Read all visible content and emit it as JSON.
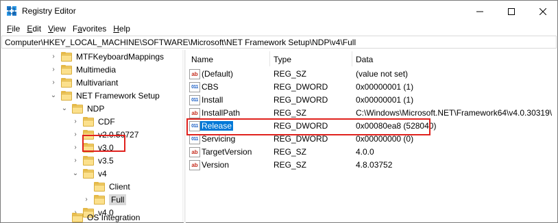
{
  "window": {
    "title": "Registry Editor",
    "icon": "registry-icon"
  },
  "menu": [
    {
      "label": "File",
      "accel": "F",
      "rest": "ile"
    },
    {
      "label": "Edit",
      "accel": "E",
      "rest": "dit"
    },
    {
      "label": "View",
      "accel": "V",
      "rest": "iew"
    },
    {
      "label": "Favorites",
      "accel": "a",
      "pre": "F",
      "rest": "vorites"
    },
    {
      "label": "Help",
      "accel": "H",
      "rest": "elp"
    }
  ],
  "address": "Computer\\HKEY_LOCAL_MACHINE\\SOFTWARE\\Microsoft\\NET Framework Setup\\NDP\\v4\\Full",
  "tree": [
    {
      "label": "MTFKeyboardMappings",
      "chevron": ">"
    },
    {
      "label": "Multimedia",
      "chevron": ">"
    },
    {
      "label": "Multivariant",
      "chevron": ">"
    },
    {
      "label": "NET Framework Setup",
      "chevron": "v"
    },
    {
      "label": "NDP",
      "chevron": "v"
    },
    {
      "label": "CDF",
      "chevron": ">"
    },
    {
      "label": "v2.0.50727",
      "chevron": ">"
    },
    {
      "label": "v3.0",
      "chevron": ">"
    },
    {
      "label": "v3.5",
      "chevron": ">"
    },
    {
      "label": "v4",
      "chevron": "v"
    },
    {
      "label": "Client",
      "chevron": ""
    },
    {
      "label": "Full",
      "chevron": ">"
    },
    {
      "label": "v4.0",
      "chevron": ">"
    },
    {
      "label": "OS Integration",
      "chevron": ""
    }
  ],
  "columns": {
    "name": "Name",
    "type": "Type",
    "data": "Data"
  },
  "values": [
    {
      "name": "(Default)",
      "type": "REG_SZ",
      "data": "(value not set)",
      "icon": "string-value-icon"
    },
    {
      "name": "CBS",
      "type": "REG_DWORD",
      "data": "0x00000001 (1)",
      "icon": "dword-value-icon"
    },
    {
      "name": "Install",
      "type": "REG_DWORD",
      "data": "0x00000001 (1)",
      "icon": "dword-value-icon"
    },
    {
      "name": "InstallPath",
      "type": "REG_SZ",
      "data": "C:\\Windows\\Microsoft.NET\\Framework64\\v4.0.30319\\",
      "icon": "string-value-icon"
    },
    {
      "name": "Release",
      "type": "REG_DWORD",
      "data": "0x00080ea8 (528040)",
      "icon": "dword-value-icon"
    },
    {
      "name": "Servicing",
      "type": "REG_DWORD",
      "data": "0x00000000 (0)",
      "icon": "dword-value-icon"
    },
    {
      "name": "TargetVersion",
      "type": "REG_SZ",
      "data": "4.0.0",
      "icon": "string-value-icon"
    },
    {
      "name": "Version",
      "type": "REG_SZ",
      "data": "4.8.03752",
      "icon": "string-value-icon"
    }
  ],
  "colors": {
    "highlight_border": "#e0201c",
    "selection": "#0078d7"
  }
}
